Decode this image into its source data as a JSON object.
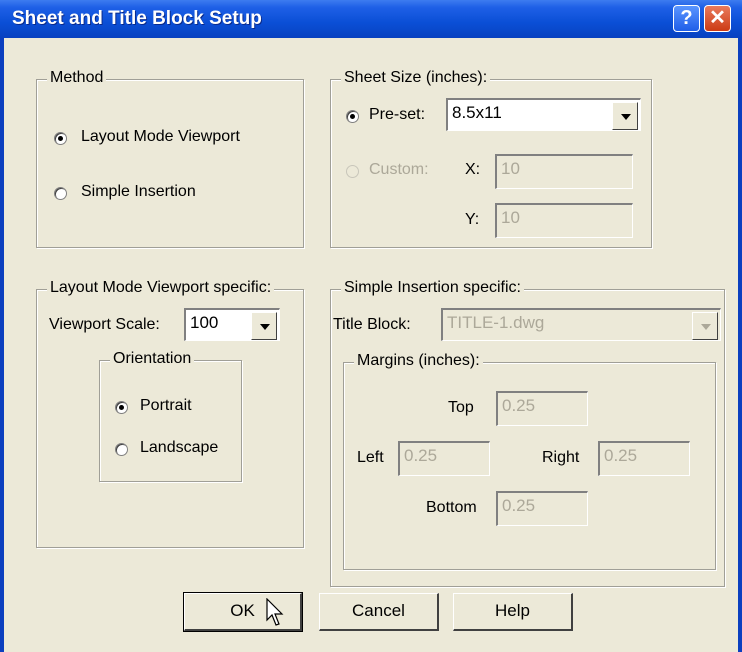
{
  "window": {
    "title": "Sheet and Title Block Setup",
    "help_glyph": "?",
    "close_glyph": "✕"
  },
  "method": {
    "legend": "Method",
    "options": [
      {
        "label": "Layout Mode Viewport",
        "selected": true
      },
      {
        "label": "Simple Insertion",
        "selected": false
      }
    ]
  },
  "sheet_size": {
    "legend": "Sheet Size (inches):",
    "preset_label": "Pre-set:",
    "preset_value": "8.5x11",
    "custom_label": "Custom:",
    "x_label": "X:",
    "x_value": "10",
    "y_label": "Y:",
    "y_value": "10"
  },
  "layout_specific": {
    "legend": "Layout Mode Viewport specific:",
    "scale_label": "Viewport Scale:",
    "scale_value": "100",
    "orientation": {
      "legend": "Orientation",
      "options": [
        {
          "label": "Portrait",
          "selected": true
        },
        {
          "label": "Landscape",
          "selected": false
        }
      ]
    }
  },
  "simple_specific": {
    "legend": "Simple Insertion specific:",
    "title_block_label": "Title Block:",
    "title_block_value": "TITLE-1.dwg",
    "margins": {
      "legend": "Margins (inches):",
      "top_label": "Top",
      "top_value": "0.25",
      "left_label": "Left",
      "left_value": "0.25",
      "right_label": "Right",
      "right_value": "0.25",
      "bottom_label": "Bottom",
      "bottom_value": "0.25"
    }
  },
  "buttons": {
    "ok": "OK",
    "cancel": "Cancel",
    "help": "Help"
  }
}
